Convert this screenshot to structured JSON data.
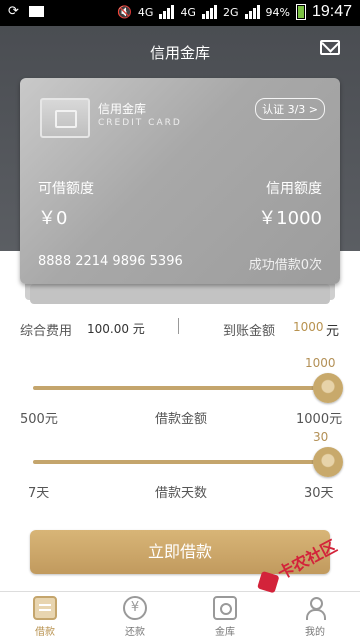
{
  "status_bar": {
    "network_1": "4G",
    "network_2": "4G",
    "network_3": "2G",
    "battery": "94%",
    "time": "19:47"
  },
  "header": {
    "title": "信用金库",
    "mail_icon": "mail-icon"
  },
  "card": {
    "name": "信用金库",
    "subtitle": "CREDIT CARD",
    "verify_badge": "认证 3/3 >",
    "available_label": "可借额度",
    "available_value": "￥0",
    "limit_label": "信用额度",
    "limit_value": "￥1000",
    "number": "8888 2214 9896 5396",
    "loan_count": "成功借款0次"
  },
  "fees": {
    "total_fee_label": "综合费用",
    "total_fee_value": "100.00 元",
    "received_label": "到账金额",
    "received_value": "1000",
    "received_unit": "元"
  },
  "amount_slider": {
    "current": "1000",
    "min_label": "500元",
    "label": "借款金额",
    "max_label": "1000元",
    "fraction": 1.0
  },
  "days_slider": {
    "current": "30",
    "min_label": "7天",
    "label": "借款天数",
    "max_label": "30天",
    "fraction": 1.0
  },
  "apply_button": "立即借款",
  "nav": [
    {
      "label": "借款",
      "icon": "loan-icon",
      "active": true
    },
    {
      "label": "还款",
      "icon": "yen-circle-icon",
      "active": false
    },
    {
      "label": "金库",
      "icon": "vault-icon",
      "active": false
    },
    {
      "label": "我的",
      "icon": "user-icon",
      "active": false
    }
  ],
  "watermark": "卡农社区",
  "colors": {
    "accent": "#c4a56c",
    "header_bg": "#4f5257",
    "accent_text": "#b8924f"
  }
}
